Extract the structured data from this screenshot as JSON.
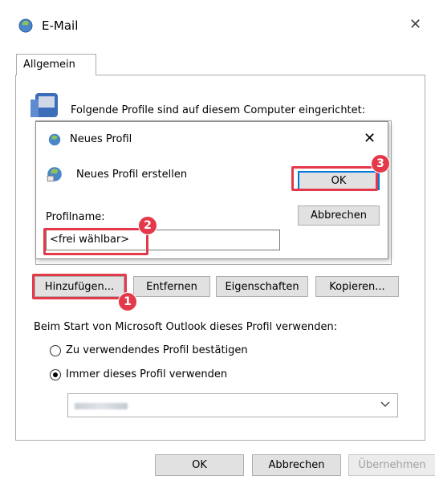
{
  "window": {
    "title": "E-Mail",
    "close_glyph": "✕"
  },
  "tabs": [
    {
      "label": "Allgemein"
    }
  ],
  "profiles_heading": "Folgende Profile sind auf diesem Computer eingerichtet:",
  "profile_buttons": {
    "add": "Hinzufügen...",
    "remove": "Entfernen",
    "properties": "Eigenschaften",
    "copy": "Kopieren..."
  },
  "startup": {
    "heading": "Beim Start von Microsoft Outlook dieses Profil verwenden:",
    "option_confirm": "Zu verwendendes Profil bestätigen",
    "option_always": "Immer dieses Profil verwenden",
    "selected_option": "always"
  },
  "footer": {
    "ok": "OK",
    "cancel": "Abbrechen",
    "apply": "Übernehmen"
  },
  "dialog": {
    "title": "Neues Profil",
    "close_glyph": "✕",
    "description": "Neues Profil erstellen",
    "profile_name_label": "Profilname:",
    "profile_name_value": "<frei wählbar>",
    "ok": "OK",
    "cancel": "Abbrechen"
  },
  "annotations": {
    "badge1": "1",
    "badge2": "2",
    "badge3": "3"
  },
  "colors": {
    "highlight": "#e3394b",
    "default_button_border": "#0078d7"
  }
}
